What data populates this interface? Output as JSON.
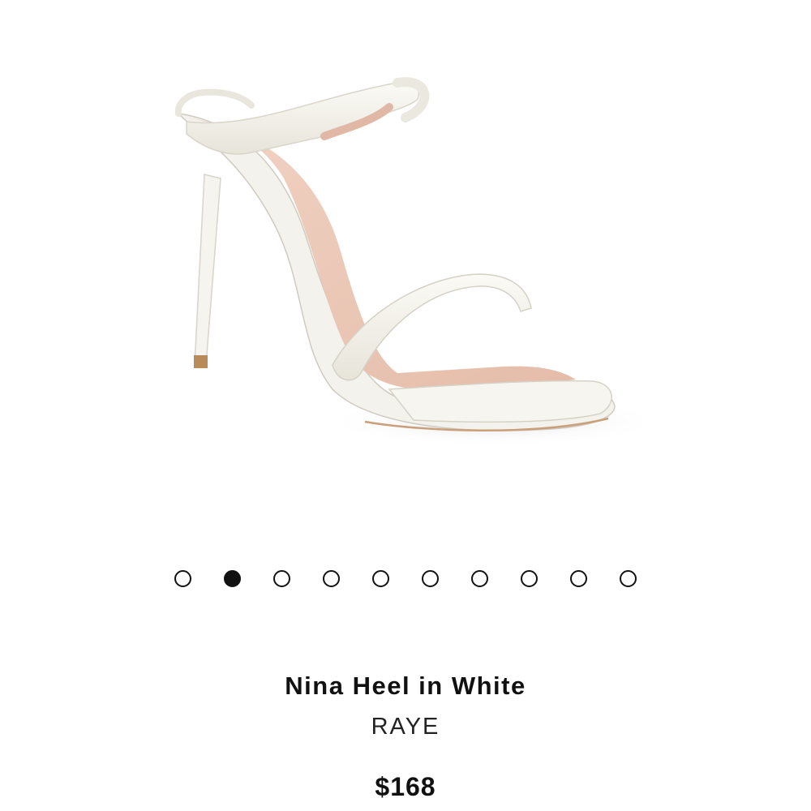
{
  "product": {
    "title": "Nina Heel in White",
    "brand": "RAYE",
    "price": "$168",
    "image_icon": "product-photo-white-strappy-heel"
  },
  "carousel": {
    "total": 10,
    "active_index": 1
  },
  "colors": {
    "dot": "#111111",
    "strap": "#f3f1ea",
    "insole": "#ecc8b8",
    "heel_tip": "#b98a5a"
  }
}
